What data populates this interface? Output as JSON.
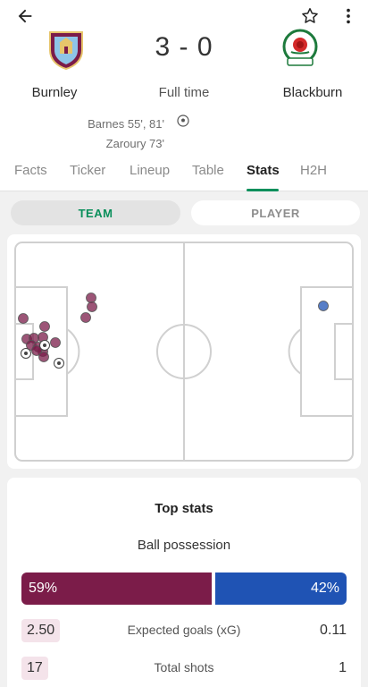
{
  "match": {
    "home_team": "Burnley",
    "away_team": "Blackburn",
    "score": "3 - 0",
    "status": "Full time",
    "scorers": [
      "Barnes 55', 81'",
      "Zaroury 73'"
    ]
  },
  "tabs": [
    "Facts",
    "Ticker",
    "Lineup",
    "Table",
    "Stats",
    "H2H"
  ],
  "active_tab": "Stats",
  "toggle": {
    "team": "TEAM",
    "player": "PLAYER"
  },
  "stats": {
    "title": "Top stats",
    "possession_label": "Ball possession",
    "possession_home": "59%",
    "possession_away": "42%",
    "possession_home_fraction": 0.59,
    "rows": [
      {
        "home": "2.50",
        "label": "Expected goals (xG)",
        "away": "0.11"
      },
      {
        "home": "17",
        "label": "Total shots",
        "away": "1"
      }
    ]
  },
  "colors": {
    "home": "#7b1c49",
    "away": "#1f53b4",
    "accent": "#0a8f5b"
  }
}
